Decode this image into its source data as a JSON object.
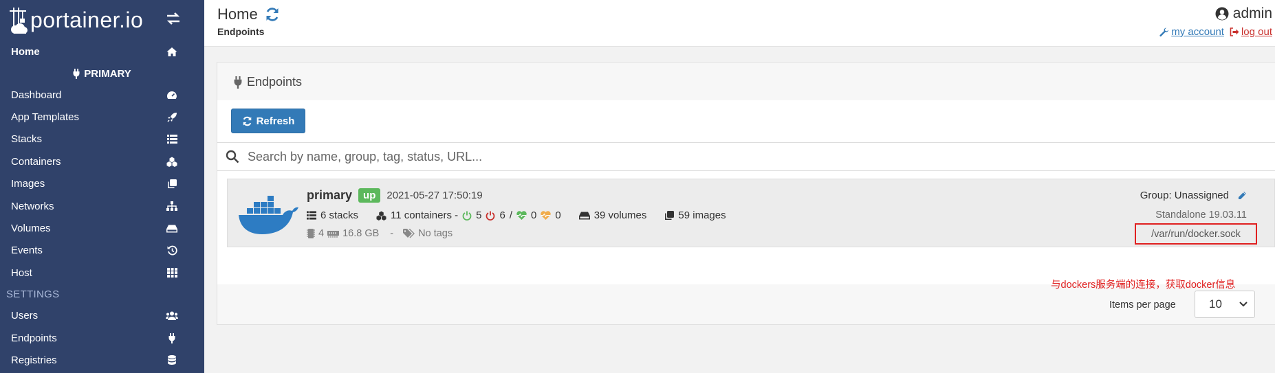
{
  "brand": {
    "name": "portainer.io"
  },
  "sidebar": {
    "home_label": "Home",
    "endpoint_title": "PRIMARY",
    "items": [
      {
        "label": "Dashboard",
        "icon": "tachometer-icon"
      },
      {
        "label": "App Templates",
        "icon": "rocket-icon"
      },
      {
        "label": "Stacks",
        "icon": "list-icon"
      },
      {
        "label": "Containers",
        "icon": "cubes-icon"
      },
      {
        "label": "Images",
        "icon": "clone-icon"
      },
      {
        "label": "Networks",
        "icon": "sitemap-icon"
      },
      {
        "label": "Volumes",
        "icon": "hdd-icon"
      },
      {
        "label": "Events",
        "icon": "history-icon"
      },
      {
        "label": "Host",
        "icon": "th-icon"
      }
    ],
    "settings_title": "SETTINGS",
    "settings_items": [
      {
        "label": "Users",
        "icon": "users-icon"
      },
      {
        "label": "Endpoints",
        "icon": "plug-icon"
      },
      {
        "label": "Registries",
        "icon": "database-icon"
      }
    ]
  },
  "header": {
    "title": "Home",
    "breadcrumb": "Endpoints",
    "username": "admin",
    "my_account": "my account",
    "log_out": "log out"
  },
  "widget": {
    "title": "Endpoints",
    "refresh_label": "Refresh",
    "search_placeholder": "Search by name, group, tag, status, URL..."
  },
  "endpoint": {
    "name": "primary",
    "status": "up",
    "date": "2021-05-27 17:50:19",
    "stacks": "6 stacks",
    "containers": "11 containers -",
    "running": "5",
    "stopped": "6",
    "slash": "/",
    "healthy": "0",
    "unhealthy": "0",
    "volumes": "39 volumes",
    "images": "59 images",
    "cpu": "4",
    "memory": "16.8 GB",
    "dash": "-",
    "tags": "No tags",
    "group": "Group: Unassigned",
    "version": "Standalone 19.03.11",
    "url": "/var/run/docker.sock"
  },
  "annotation": "与dockers服务端的连接，获取docker信息",
  "pagination": {
    "items_per_page_label": "Items per page",
    "value": "10"
  },
  "colors": {
    "sidebar": "#30426a",
    "primary": "#337ab7",
    "success": "#5cb85c",
    "danger": "#c9302c",
    "annotation": "#e02020"
  }
}
